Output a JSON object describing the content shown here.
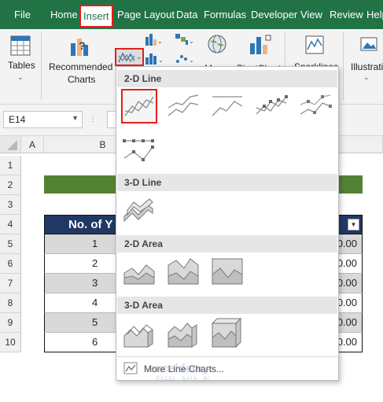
{
  "tabs": [
    "File",
    "Home",
    "Insert",
    "Page Layout",
    "Data",
    "Formulas",
    "Developer",
    "View",
    "Review",
    "Help"
  ],
  "active_tab": "Insert",
  "ribbon": {
    "tables_label": "Tables",
    "recommended_charts_label_1": "Recommended",
    "recommended_charts_label_2": "Charts",
    "maps_label": "Maps",
    "pivotchart_label": "PivotChart",
    "sparklines_label": "Sparklines",
    "illustrations_label": "Illustrations"
  },
  "name_box": {
    "value": "E14"
  },
  "columns": [
    "A",
    "B"
  ],
  "rows": [
    "1",
    "2",
    "3",
    "4",
    "5",
    "6",
    "7",
    "8",
    "9",
    "10"
  ],
  "table": {
    "header": "No. of Y",
    "row_numbers": [
      "1",
      "2",
      "3",
      "4",
      "5",
      "6"
    ],
    "row_values_visible": [
      "0.00",
      "0.00",
      "0.00",
      "0.00",
      "0.00",
      "0.00"
    ]
  },
  "dropdown": {
    "sections": [
      "2-D Line",
      "3-D Line",
      "2-D Area",
      "3-D Area"
    ],
    "more_label": "More Line Charts..."
  },
  "watermark": {
    "main": "exceldemy",
    "sub": "EXCEL · DATA · BI"
  },
  "colors": {
    "excel_green": "#217346",
    "header_navy": "#203864",
    "title_green": "#548235",
    "highlight_red": "#e0201b",
    "row_shade": "#d9d9d9"
  }
}
